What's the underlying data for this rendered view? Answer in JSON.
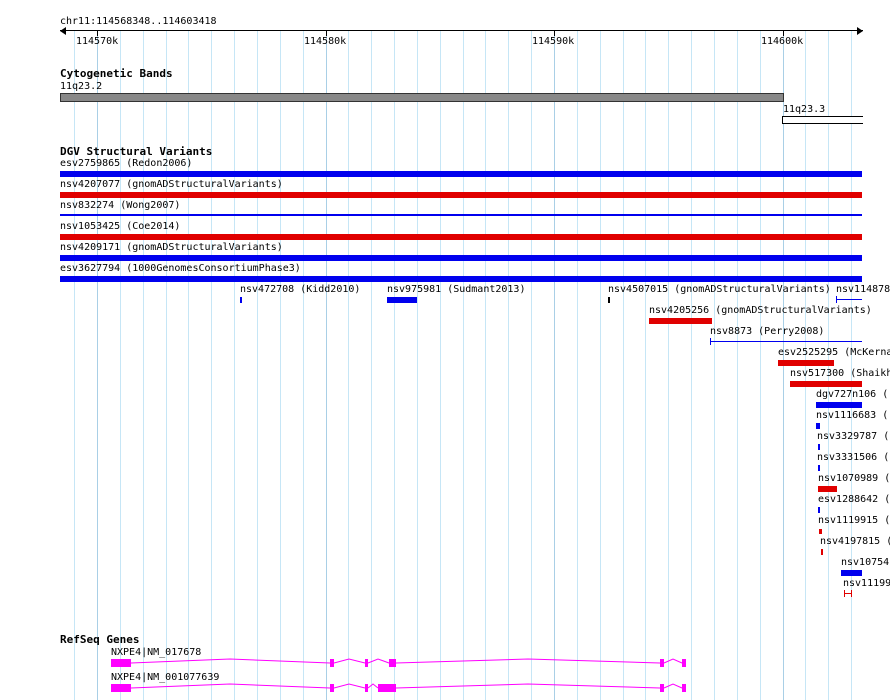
{
  "locus": "chr11:114568348..114603418",
  "ruler": {
    "ticks": [
      "114570k",
      "114580k",
      "114590k",
      "114600k"
    ]
  },
  "tracks": {
    "cytoband": {
      "title": "Cytogenetic Bands",
      "bands": [
        {
          "name": "11q23.2",
          "color": "#888888"
        },
        {
          "name": "11q23.3",
          "color": "#ffffff"
        }
      ]
    },
    "dgv": {
      "title": "DGV Structural Variants",
      "colors": {
        "loss": "#e00000",
        "gain": "#0000ee",
        "gain_loss": "#0000ee"
      },
      "features": [
        {
          "label": "esv2759865 (Redon2006)",
          "type": "gain"
        },
        {
          "label": "nsv4207077 (gnomADStructuralVariants)",
          "type": "loss"
        },
        {
          "label": "nsv832274 (Wong2007)",
          "type": "gain"
        },
        {
          "label": "nsv1053425 (Coe2014)",
          "type": "loss"
        },
        {
          "label": "nsv4209171 (gnomADStructuralVariants)",
          "type": "gain"
        },
        {
          "label": "esv3627794 (1000GenomesConsortiumPhase3)",
          "type": "gain"
        },
        {
          "label": "nsv472708 (Kidd2010)",
          "type": "gain"
        },
        {
          "label": "nsv975981 (Sudmant2013)",
          "type": "gain"
        },
        {
          "label": "nsv4507015 (gnomADStructuralVariants)",
          "type": "other"
        },
        {
          "label": "nsv114878",
          "type": "gain"
        },
        {
          "label": "nsv4205256 (gnomADStructuralVariants)",
          "type": "loss"
        },
        {
          "label": "nsv8873 (Perry2008)",
          "type": "gain"
        },
        {
          "label": "esv2525295 (McKerna",
          "type": "loss"
        },
        {
          "label": "nsv517300 (Shaikh",
          "type": "loss"
        },
        {
          "label": "dgv727n106 (",
          "type": "gain"
        },
        {
          "label": "nsv1116683 (",
          "type": "gain"
        },
        {
          "label": "nsv3329787 (",
          "type": "gain"
        },
        {
          "label": "nsv3331506 (",
          "type": "gain"
        },
        {
          "label": "nsv1070989 (",
          "type": "loss"
        },
        {
          "label": "esv1288642 (",
          "type": "gain"
        },
        {
          "label": "nsv1119915 (",
          "type": "loss"
        },
        {
          "label": "nsv4197815 (",
          "type": "loss"
        },
        {
          "label": "nsv10754",
          "type": "gain"
        },
        {
          "label": "nsv11199",
          "type": "loss"
        }
      ]
    },
    "refseq": {
      "title": "RefSeq Genes",
      "color": "#ff00ff",
      "transcripts": [
        {
          "label": "NXPE4|NM_017678"
        },
        {
          "label": "NXPE4|NM_001077639"
        }
      ]
    }
  }
}
